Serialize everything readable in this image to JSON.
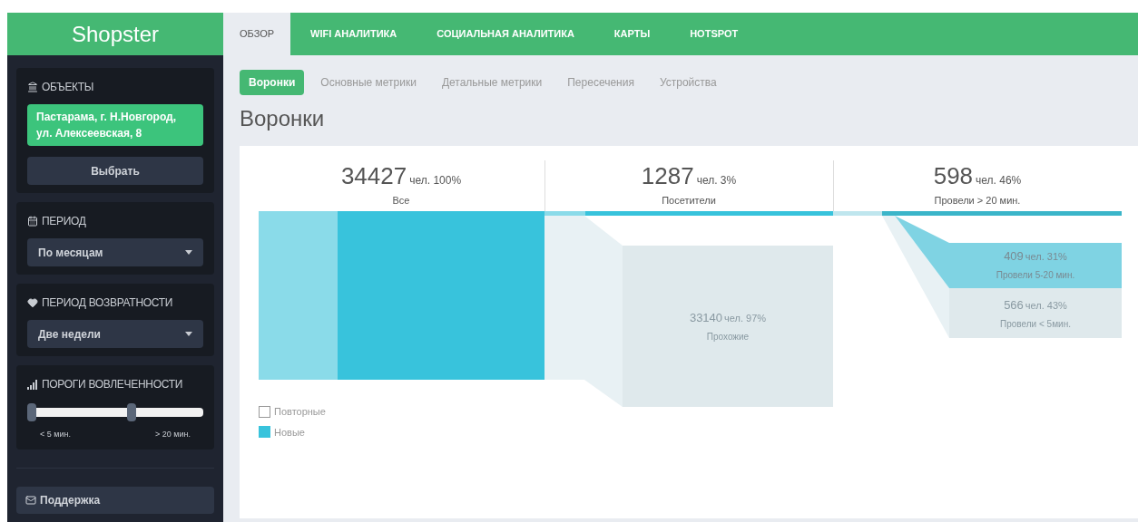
{
  "brand": "Shopster",
  "sidebar": {
    "panels": [
      {
        "kind": "picker",
        "title": "ОБЪЕКТЫ",
        "value": "Пастарама, г. Н.Новгород, ул. Алексеевская, 8",
        "button": "Выбрать"
      },
      {
        "kind": "select",
        "title": "ПЕРИОД",
        "value": "По месяцам"
      },
      {
        "kind": "select",
        "title": "ПЕРИОД ВОЗВРАТНОСТИ",
        "value": "Две недели"
      },
      {
        "kind": "slider",
        "title": "ПОРОГИ ВОВЛЕЧЕННОСТИ",
        "thumbs": [
          {
            "level": 0,
            "label": "< 5 мин."
          },
          {
            "level": 0.6,
            "label": "> 20 мин."
          }
        ]
      }
    ],
    "support": "Поддержка"
  },
  "tabs": [
    {
      "label": "ОБЗОР",
      "selected": true
    },
    {
      "label": "WIFI АНАЛИТИКА",
      "selected": false
    },
    {
      "label": "СОЦИАЛЬНАЯ АНАЛИТИКА",
      "selected": false
    },
    {
      "label": "КАРТЫ",
      "selected": false
    },
    {
      "label": "HOTSPOT",
      "selected": false
    }
  ],
  "subtabs": [
    {
      "label": "Воронки",
      "selected": true
    },
    {
      "label": "Основные метрики",
      "selected": false
    },
    {
      "label": "Детальные метрики",
      "selected": false
    },
    {
      "label": "Пересечения",
      "selected": false
    },
    {
      "label": "Устройства",
      "selected": false
    }
  ],
  "title": "Воронки",
  "funnel": {
    "stages": [
      {
        "count": "34427",
        "unit": "чел. 100%",
        "label": "Все"
      },
      {
        "count": "1287",
        "unit": "чел. 3%",
        "label": "Посетители"
      },
      {
        "count": "598",
        "unit": "чел. 46%",
        "label": "Провели > 20 мин."
      }
    ],
    "branches": [
      {
        "count": "33140",
        "unit": "чел. 97%",
        "label": "Прохожие"
      },
      {
        "count": "409",
        "unit": "чел. 31%",
        "label": "Провели 5-20 мин."
      },
      {
        "count": "566",
        "unit": "чел. 43%",
        "label": "Провели < 5мин."
      }
    ],
    "legend": [
      {
        "label": "Повторные",
        "checked": false
      },
      {
        "label": "Новые",
        "checked": true
      }
    ]
  }
}
